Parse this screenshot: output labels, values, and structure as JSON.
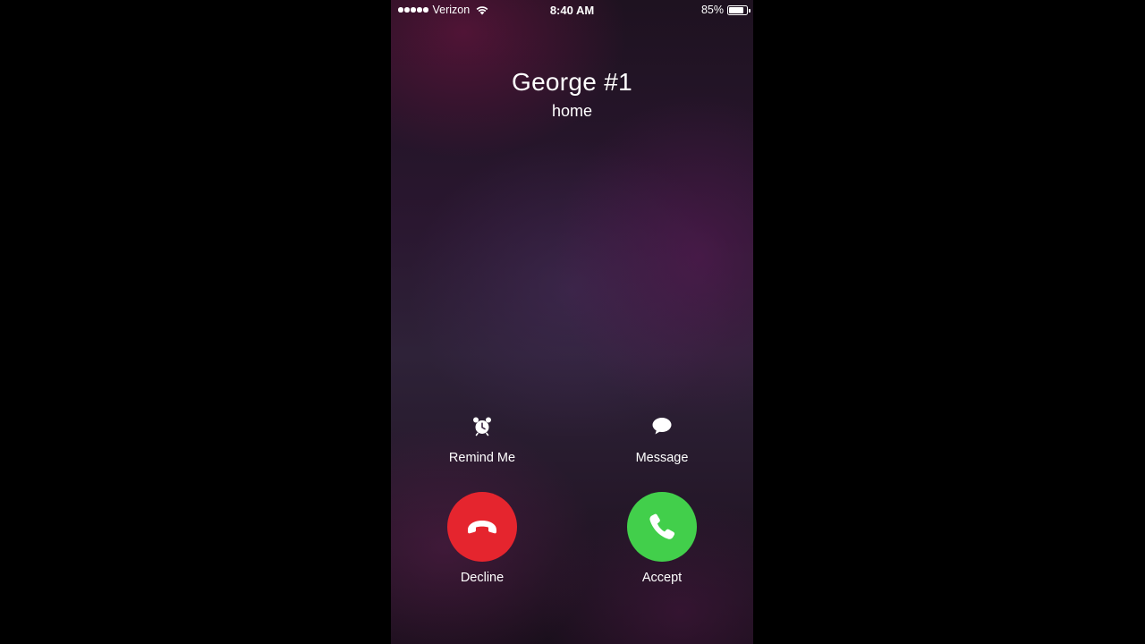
{
  "status_bar": {
    "carrier": "Verizon",
    "time": "8:40 AM",
    "battery": "85%",
    "battery_level": 0.85
  },
  "caller": {
    "name": "George #1",
    "label": "home"
  },
  "actions": {
    "remind_me": "Remind Me",
    "message": "Message",
    "decline": "Decline",
    "accept": "Accept"
  },
  "colors": {
    "decline": "#e5252e",
    "accept": "#42cf4b"
  },
  "icons": {
    "remind_me": "alarm-clock-icon",
    "message": "speech-bubble-icon",
    "decline": "hang-up-handset-icon",
    "accept": "phone-handset-icon"
  }
}
